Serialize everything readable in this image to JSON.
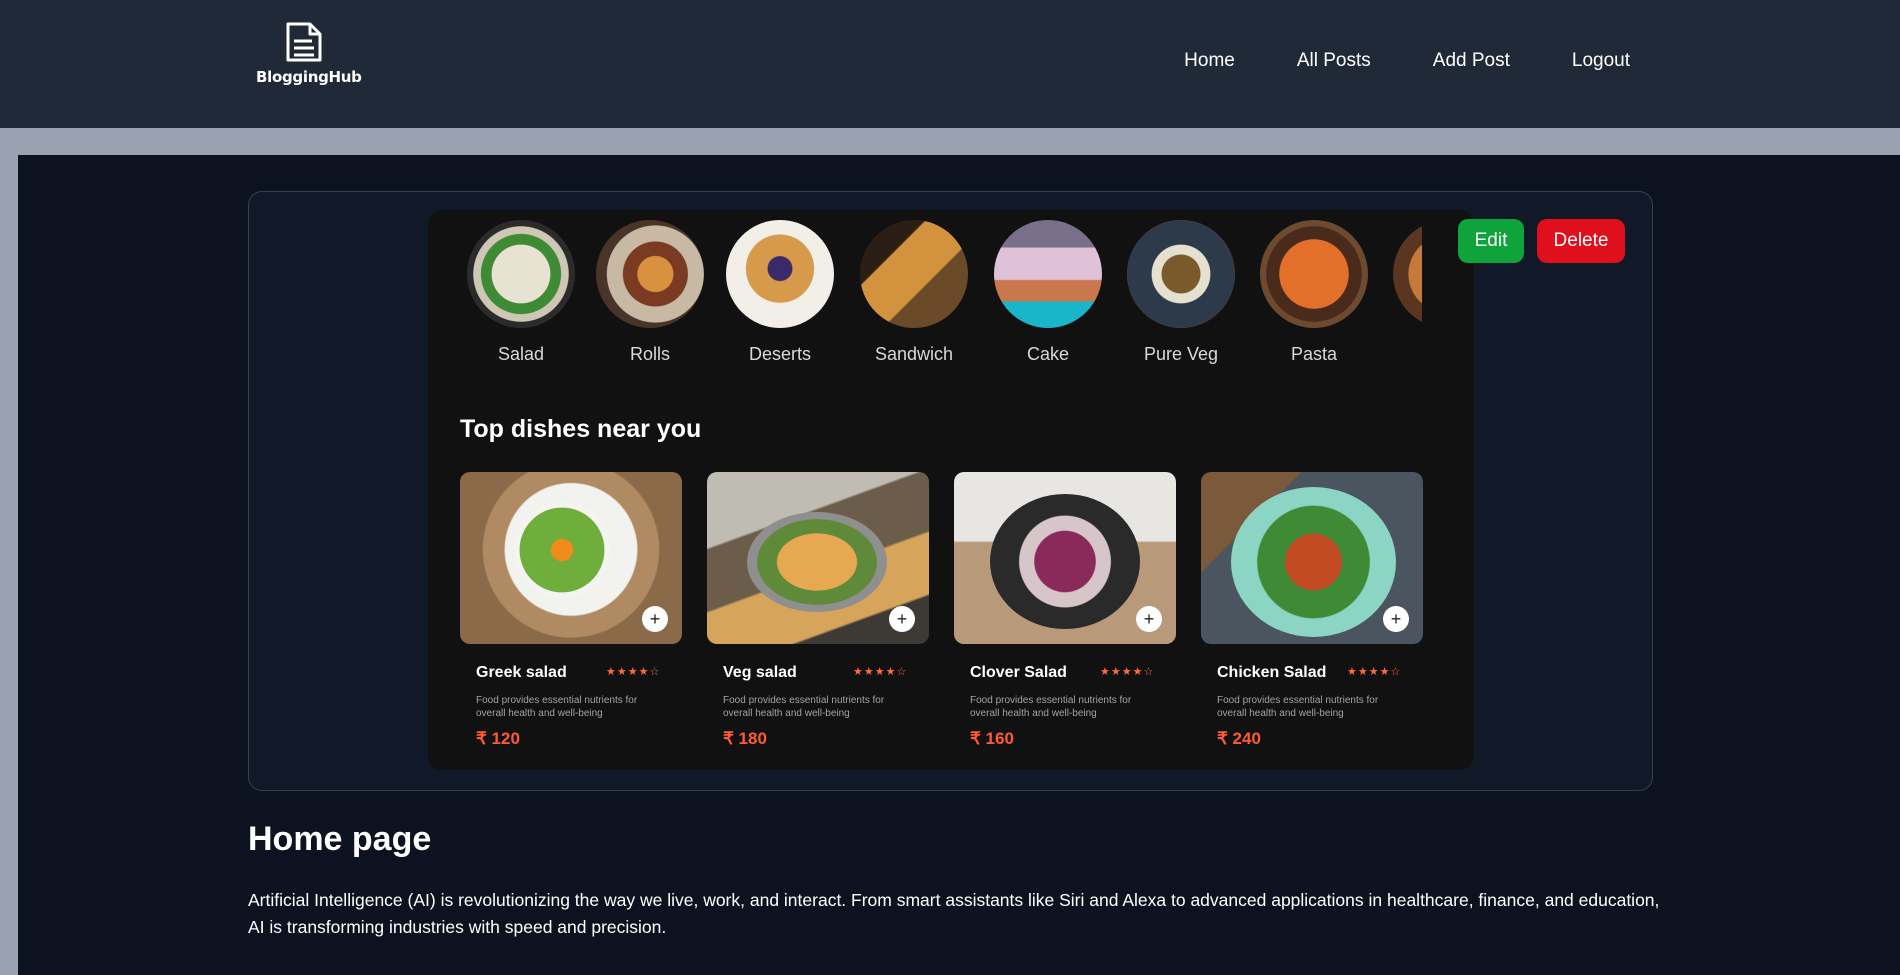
{
  "header": {
    "logo_text": "BloggingHub",
    "logo_icon": "document-icon",
    "nav": [
      "Home",
      "All Posts",
      "Add Post",
      "Logout"
    ]
  },
  "post": {
    "edit_label": "Edit",
    "delete_label": "Delete",
    "image": {
      "categories": [
        "Salad",
        "Rolls",
        "Deserts",
        "Sandwich",
        "Cake",
        "Pure Veg",
        "Pasta"
      ],
      "section_title": "Top dishes near you",
      "dishes": [
        {
          "name": "Greek salad",
          "desc": "Food provides essential nutrients for overall health and well-being",
          "price": "₹ 120",
          "rating": 4
        },
        {
          "name": "Veg salad",
          "desc": "Food provides essential nutrients for overall health and well-being",
          "price": "₹ 180",
          "rating": 4
        },
        {
          "name": "Clover Salad",
          "desc": "Food provides essential nutrients for overall health and well-being",
          "price": "₹ 160",
          "rating": 4
        },
        {
          "name": "Chicken Salad",
          "desc": "Food provides essential nutrients for overall health and well-being",
          "price": "₹ 240",
          "rating": 4
        }
      ],
      "add_symbol": "+"
    }
  },
  "article": {
    "title": "Home page",
    "body": "Artificial Intelligence (AI) is revolutionizing the way we live, work, and interact. From smart assistants like Siri and Alexa to advanced applications in healthcare, finance, and education, AI is transforming industries with speed and precision."
  },
  "colors": {
    "header_bg": "#1f2937",
    "edit_button": "#0ea43b",
    "delete_button": "#e00f1c",
    "price": "#ff5a36",
    "stars": "#ff6b3d"
  }
}
